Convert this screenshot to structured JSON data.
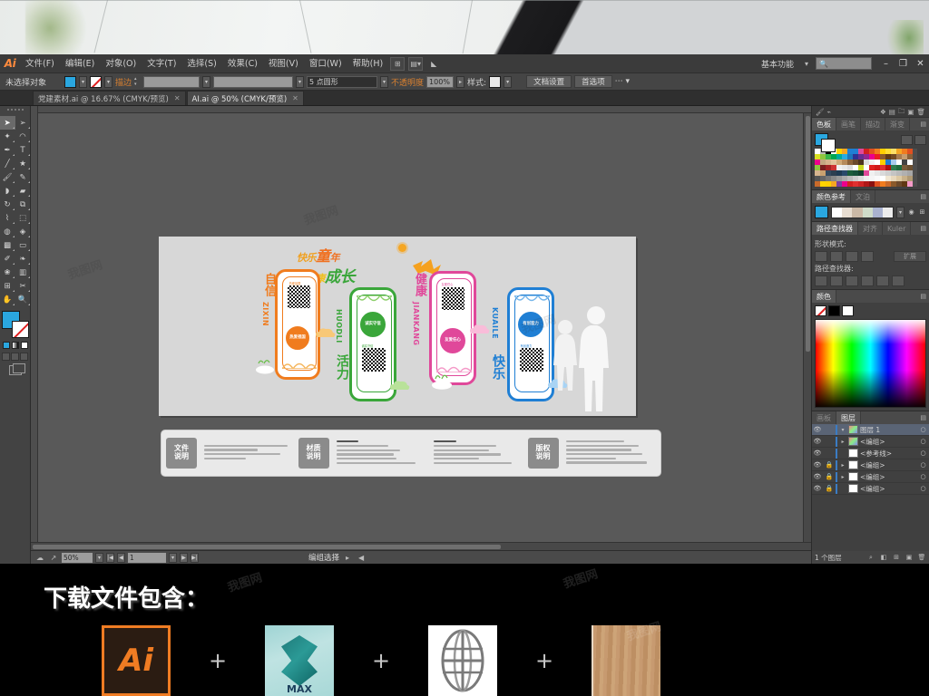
{
  "app": {
    "logo": "Ai",
    "workspace": "基本功能",
    "search_placeholder": "",
    "window_buttons": [
      "–",
      "❐",
      "✕"
    ]
  },
  "menubar": {
    "items": [
      {
        "label": "文件(F)"
      },
      {
        "label": "编辑(E)"
      },
      {
        "label": "对象(O)"
      },
      {
        "label": "文字(T)"
      },
      {
        "label": "选择(S)"
      },
      {
        "label": "效果(C)"
      },
      {
        "label": "视图(V)"
      },
      {
        "label": "窗口(W)"
      },
      {
        "label": "帮助(H)"
      }
    ]
  },
  "controlbar": {
    "selection_status": "未选择对象",
    "stroke_label": "描边",
    "stroke_weight": "",
    "profile": "5 点圆形",
    "opacity_label": "不透明度",
    "opacity_value": "100%",
    "style_label": "样式:",
    "doc_setup": "文档设置",
    "preferences": "首选项"
  },
  "tabs": [
    {
      "label": "党建素材.ai @ 16.67% (CMYK/预览)",
      "close": "✕",
      "active": false
    },
    {
      "label": "AI.ai @ 50% (CMYK/预览)",
      "close": "✕",
      "active": true
    }
  ],
  "tools": {
    "rows": [
      [
        "selection-tool",
        "direct-selection-tool"
      ],
      [
        "magic-wand-tool",
        "lasso-tool"
      ],
      [
        "pen-tool",
        "type-tool"
      ],
      [
        "line-tool",
        "shape-tool"
      ],
      [
        "paintbrush-tool",
        "pencil-tool"
      ],
      [
        "blob-brush-tool",
        "eraser-tool"
      ],
      [
        "rotate-tool",
        "scale-tool"
      ],
      [
        "width-tool",
        "free-transform-tool"
      ],
      [
        "shape-builder-tool",
        "perspective-grid-tool"
      ],
      [
        "mesh-tool",
        "gradient-tool"
      ],
      [
        "eyedropper-tool",
        "blend-tool"
      ],
      [
        "symbol-sprayer-tool",
        "column-graph-tool"
      ],
      [
        "artboard-tool",
        "slice-tool"
      ],
      [
        "hand-tool",
        "zoom-tool"
      ]
    ],
    "fill_color": "#2aa7e0",
    "stroke_color": "#ffffff"
  },
  "statusbar": {
    "zoom": "50%",
    "page": "1",
    "tool": "编组选择"
  },
  "dock": {
    "panels": [
      {
        "name": "swatches",
        "tabs": [
          "色板",
          "画笔",
          "描边",
          "渐变"
        ],
        "active_tab": "色板"
      },
      {
        "name": "color-guide",
        "tabs": [
          "颜色参考",
          "文泊"
        ],
        "active_tab": "颜色参考"
      },
      {
        "name": "pathfinder",
        "tabs": [
          "路径查找器",
          "对齐",
          "Kuler"
        ],
        "active_tab": "路径查找器",
        "shape_modes_label": "形状模式:",
        "expand_label": "扩展",
        "pathfinders_label": "路径查找器:"
      },
      {
        "name": "color",
        "tabs": [
          "颜色"
        ],
        "active_tab": "颜色",
        "footer_tabs": [
          "画板",
          "图层"
        ]
      }
    ],
    "layers_panel": {
      "tabs": [
        "画板",
        "图层"
      ],
      "active_tab": "图层",
      "rows": [
        {
          "name": "图层 1",
          "selected": true,
          "locked": false,
          "expandable": true,
          "thumb": "art"
        },
        {
          "name": "<编组>",
          "selected": false,
          "locked": false,
          "expandable": true,
          "thumb": "art"
        },
        {
          "name": "<参考线>",
          "selected": false,
          "locked": false,
          "expandable": false,
          "thumb": "white"
        },
        {
          "name": "<编组>",
          "selected": false,
          "locked": true,
          "expandable": true,
          "thumb": "white"
        },
        {
          "name": "<编组>",
          "selected": false,
          "locked": true,
          "expandable": true,
          "thumb": "white"
        },
        {
          "name": "<编组>",
          "selected": false,
          "locked": true,
          "expandable": false,
          "thumb": "white"
        }
      ],
      "footer_count": "1 个图层"
    }
  },
  "artwork": {
    "headline": {
      "line1_part1": "快乐",
      "line1_part2": "童",
      "line1_part3": "年",
      "line2_part1": "健康",
      "line2_part2": "成长"
    },
    "columns": [
      {
        "vertical_cn": "自信",
        "vertical_en": "ZIXIN",
        "badge": "热爱祖国",
        "qr_caption": "热爱祖国",
        "color": "#f07c1e"
      },
      {
        "vertical_cn": "活力",
        "vertical_en": "HUODLI",
        "badge": "诚实守信",
        "qr_caption": "诚实守信",
        "color": "#3aa63a"
      },
      {
        "vertical_cn": "健康",
        "vertical_en": "JIANKANG",
        "badge": "友爱任心",
        "qr_caption": "友爱任心",
        "color": "#e0489a"
      },
      {
        "vertical_cn": "快乐",
        "vertical_en": "KUAILE",
        "badge": "有创造力",
        "qr_caption": "有创造力",
        "color": "#1f7fd4"
      }
    ],
    "spec_sections": [
      {
        "tag_line1": "文件",
        "tag_line2": "说明"
      },
      {
        "tag_line1": "材质",
        "tag_line2": "说明"
      },
      {
        "tag_line1": "版权",
        "tag_line2": "说明"
      }
    ]
  },
  "banner": {
    "title": "下载文件包含：",
    "separator": "+",
    "items": [
      {
        "label": "Ai",
        "icon": "illustrator-file-icon"
      },
      {
        "label": "MAX",
        "icon": "3dsmax-file-icon"
      },
      {
        "label": "",
        "icon": "globe-texture-icon"
      },
      {
        "label": "",
        "icon": "wood-texture-icon"
      }
    ]
  },
  "watermark": {
    "text": "我图网"
  }
}
